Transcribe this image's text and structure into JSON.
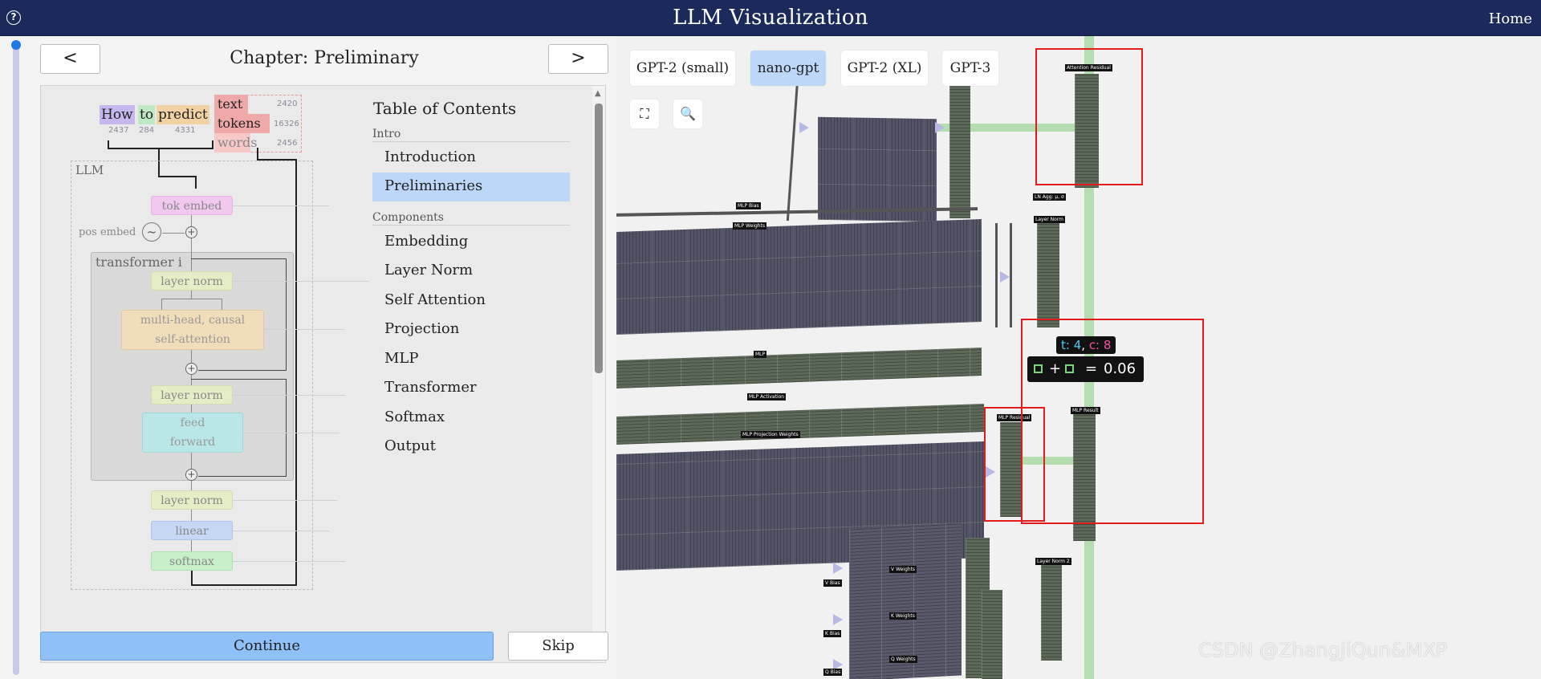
{
  "header": {
    "title": "LLM Visualization",
    "home": "Home"
  },
  "chapter": {
    "title": "Chapter: Preliminary",
    "prev": "<",
    "next": ">"
  },
  "tokens": [
    {
      "word": "How",
      "id": "2437",
      "color": "#c7b7ef"
    },
    {
      "word": "to",
      "id": "284",
      "color": "#bfe8c4"
    },
    {
      "word": "predict",
      "id": "4331",
      "color": "#f2d2a2"
    }
  ],
  "legend": [
    {
      "label": "text",
      "count": "2420"
    },
    {
      "label": "tokens",
      "count": "16326"
    },
    {
      "label": "words",
      "count": "2456"
    }
  ],
  "diagram": {
    "llm": "LLM",
    "tok_embed": "tok embed",
    "pos_embed": "pos embed",
    "transformer": "transformer i",
    "layer_norm_1": "layer norm",
    "attention_1": "multi-head, causal",
    "attention_2": "self-attention",
    "layer_norm_2": "layer norm",
    "ff_1": "feed",
    "ff_2": "forward",
    "layer_norm_3": "layer norm",
    "linear": "linear",
    "softmax": "softmax"
  },
  "toc": {
    "title": "Table of Contents",
    "sections": [
      {
        "name": "Intro",
        "items": [
          "Introduction",
          "Preliminaries"
        ]
      },
      {
        "name": "Components",
        "items": [
          "Embedding",
          "Layer Norm",
          "Self Attention",
          "Projection",
          "MLP",
          "Transformer",
          "Softmax",
          "Output"
        ]
      }
    ],
    "active": "Preliminaries"
  },
  "buttons": {
    "continue": "Continue",
    "skip": "Skip"
  },
  "models": [
    "GPT-2 (small)",
    "nano-gpt",
    "GPT-2 (XL)",
    "GPT-3"
  ],
  "active_model": "nano-gpt",
  "tools": {
    "fullscreen": "fullscreen-icon",
    "search": "search-icon"
  },
  "viz_labels": {
    "attention_residual": "Attention Residual",
    "mlp_bias": "MLP Bias",
    "mlp_weights": "MLP Weights",
    "mlp": "MLP",
    "mlp_activation": "MLP Activation",
    "mlp_projection_weights": "MLP Projection Weights",
    "ln_agg": "LN Agg: μ, σ",
    "layer_norm": "Layer Norm",
    "mlp_residual": "MLP Residual",
    "mlp_result": "MLP Result",
    "layer_norm_2": "Layer Norm 2",
    "weights_labels": [
      "V Weights",
      "K Weights",
      "Q Weights"
    ],
    "bias_labels": [
      "V Bias",
      "K Bias",
      "Q Bias"
    ]
  },
  "tooltip": {
    "t_label": "t:",
    "t_value": "4",
    "c_label": "c:",
    "c_value": "8",
    "plus": "+",
    "equals": "=",
    "value": "0.06"
  },
  "watermark": "CSDN @ZhangJiQun&MXP",
  "colors": {
    "header_bg": "#1b2a5b",
    "accent_blue": "#8fc0f8",
    "active_toc": "#bcd7f8",
    "matrix_purple": "#545468",
    "matrix_green": "#5d6a59",
    "highlight_red": "#e21b1b",
    "residual_green": "#b5deb0",
    "tooltip_t": "#4ec9f0",
    "tooltip_c": "#ff4fa3"
  }
}
